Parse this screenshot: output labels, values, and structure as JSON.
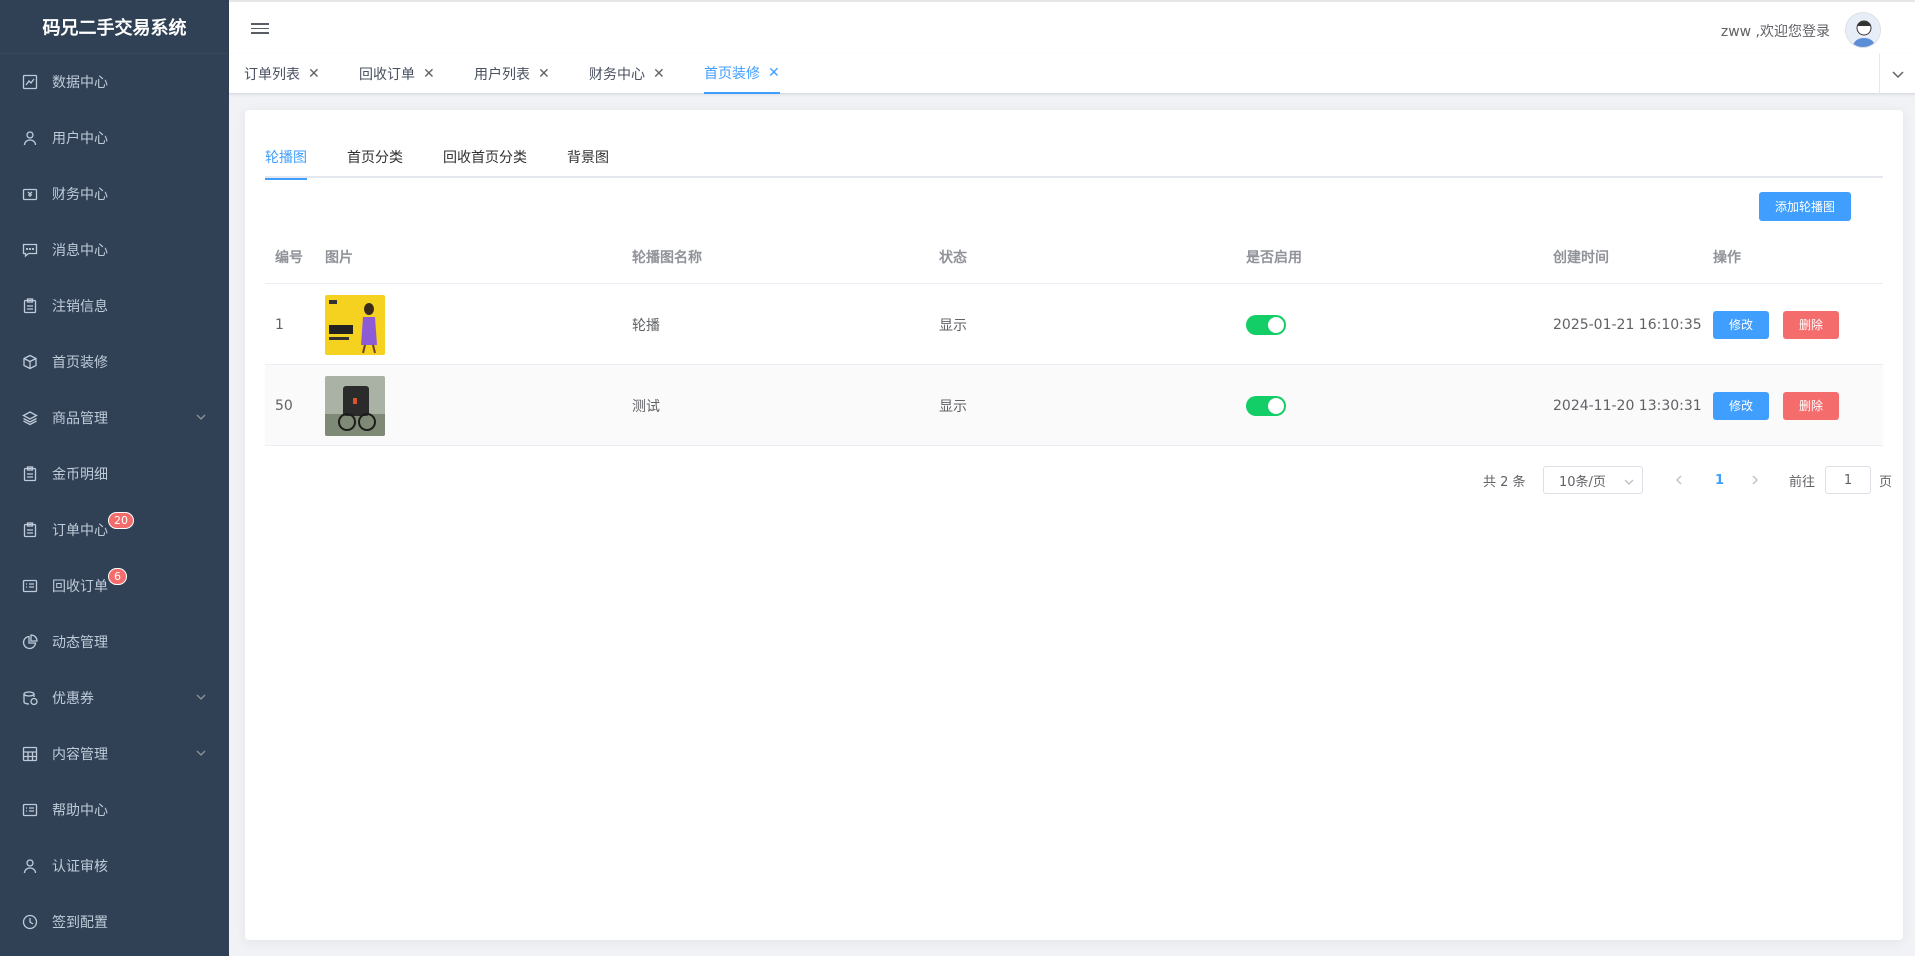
{
  "app": {
    "title": "码兄二手交易系统"
  },
  "sidebar": {
    "items": [
      {
        "label": "数据中心",
        "icon": "chart-icon"
      },
      {
        "label": "用户中心",
        "icon": "user-icon"
      },
      {
        "label": "财务中心",
        "icon": "wallet-icon"
      },
      {
        "label": "消息中心",
        "icon": "message-icon"
      },
      {
        "label": "注销信息",
        "icon": "clipboard-icon"
      },
      {
        "label": "首页装修",
        "icon": "box-icon"
      },
      {
        "label": "商品管理",
        "icon": "layers-icon",
        "expandable": true
      },
      {
        "label": "金币明细",
        "icon": "clipboard-icon"
      },
      {
        "label": "订单中心",
        "icon": "clipboard-icon",
        "badge": "20"
      },
      {
        "label": "回收订单",
        "icon": "list-icon",
        "badge": "6"
      },
      {
        "label": "动态管理",
        "icon": "pie-icon"
      },
      {
        "label": "优惠券",
        "icon": "coins-icon",
        "expandable": true
      },
      {
        "label": "内容管理",
        "icon": "grid-icon",
        "expandable": true
      },
      {
        "label": "帮助中心",
        "icon": "list-icon"
      },
      {
        "label": "认证审核",
        "icon": "user-icon"
      },
      {
        "label": "签到配置",
        "icon": "clock-icon"
      }
    ]
  },
  "header": {
    "welcome": "zww ,欢迎您登录"
  },
  "tags": [
    {
      "label": "订单列表",
      "active": false
    },
    {
      "label": "回收订单",
      "active": false
    },
    {
      "label": "用户列表",
      "active": false
    },
    {
      "label": "财务中心",
      "active": false
    },
    {
      "label": "首页装修",
      "active": true
    }
  ],
  "subtabs": [
    {
      "label": "轮播图",
      "active": true
    },
    {
      "label": "首页分类",
      "active": false
    },
    {
      "label": "回收首页分类",
      "active": false
    },
    {
      "label": "背景图",
      "active": false
    }
  ],
  "actions": {
    "add_label": "添加轮播图"
  },
  "table": {
    "columns": [
      "编号",
      "图片",
      "轮播图名称",
      "状态",
      "是否启用",
      "创建时间",
      "操作"
    ],
    "rows": [
      {
        "id": "1",
        "name": "轮播",
        "status": "显示",
        "enabled": true,
        "created": "2025-01-21 16:10:35",
        "edit": "修改",
        "delete": "删除"
      },
      {
        "id": "50",
        "name": "测试",
        "status": "显示",
        "enabled": true,
        "created": "2024-11-20 13:30:31",
        "edit": "修改",
        "delete": "删除"
      }
    ]
  },
  "pagination": {
    "total": "共 2 条",
    "page_size": "10条/页",
    "current": "1",
    "goto_prefix": "前往",
    "goto_value": "1",
    "goto_suffix": "页"
  },
  "colors": {
    "sidebar": "#304156",
    "primary": "#409eff",
    "danger": "#f56c6c",
    "success": "#13ce66"
  }
}
